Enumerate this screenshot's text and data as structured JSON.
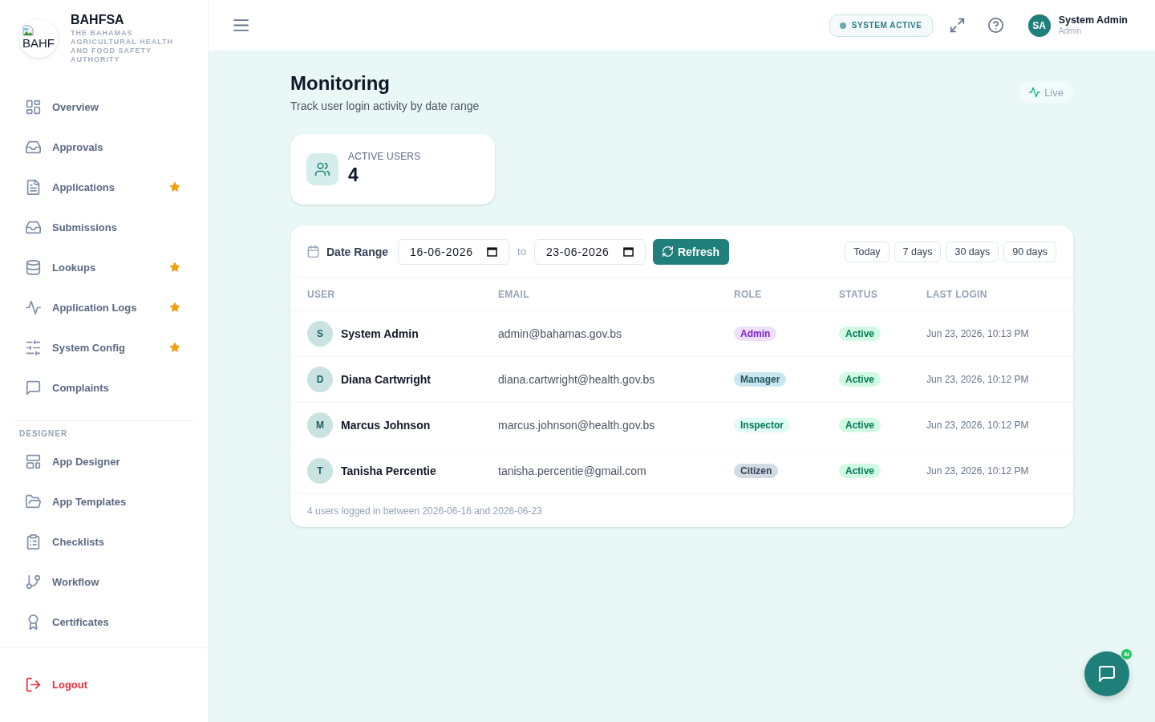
{
  "sidebar": {
    "brand": {
      "logo_text": "BAHF",
      "name": "BAHFSA",
      "subtitle": "THE BAHAMAS AGRICULTURAL HEALTH AND FOOD SAFETY AUTHORITY"
    },
    "items": [
      {
        "label": "Overview",
        "selected": false,
        "starred": false
      },
      {
        "label": "Approvals",
        "selected": false,
        "starred": false
      },
      {
        "label": "Applications",
        "selected": false,
        "starred": true
      },
      {
        "label": "Submissions",
        "selected": false,
        "starred": false
      },
      {
        "label": "Lookups",
        "selected": false,
        "starred": true
      },
      {
        "label": "Application Logs",
        "selected": false,
        "starred": true
      },
      {
        "label": "System Config",
        "selected": false,
        "starred": true
      },
      {
        "label": "Complaints",
        "selected": false,
        "starred": false
      }
    ],
    "sections": [
      {
        "title": "DESIGNER",
        "items": [
          {
            "label": "App Designer",
            "selected": false,
            "starred": false
          },
          {
            "label": "App Templates",
            "selected": false,
            "starred": false
          },
          {
            "label": "Checklists",
            "selected": false,
            "starred": false
          },
          {
            "label": "Workflow",
            "selected": false,
            "starred": false
          },
          {
            "label": "Certificates",
            "selected": false,
            "starred": false
          }
        ]
      }
    ],
    "logout": "Logout"
  },
  "header": {
    "system_status": "SYSTEM ACTIVE",
    "user": {
      "initials": "SA",
      "name": "System Admin",
      "role": "Admin"
    }
  },
  "page": {
    "title": "Monitoring",
    "subtitle": "Track user login activity by date range",
    "live": "Live"
  },
  "stats": [
    {
      "label": "ACTIVE USERS",
      "value": "4"
    }
  ],
  "activity_table": {
    "filter": {
      "label": "Date Range",
      "from": "16-06-2026",
      "separator": "to",
      "to": "23-06-2026",
      "refresh": "Refresh",
      "quick_ranges": [
        {
          "label": "Today",
          "selected": false
        },
        {
          "label": "7 days",
          "selected": false
        },
        {
          "label": "30 days",
          "selected": false
        },
        {
          "label": "90 days",
          "selected": false
        }
      ]
    },
    "columns": [
      "USER",
      "EMAIL",
      "ROLE",
      "STATUS",
      "LAST LOGIN"
    ],
    "rows": [
      {
        "initial": "S",
        "name": "System Admin",
        "email": "admin@bahamas.gov.bs",
        "role": {
          "label": "Admin",
          "color": "#7e22ce"
        },
        "status": "Active",
        "last_login": "Jun 23, 2026, 10:13 PM"
      },
      {
        "initial": "D",
        "name": "Diana Cartwright",
        "email": "diana.cartwright@health.gov.bs",
        "role": {
          "label": "Manager",
          "color": "#1f5560"
        },
        "status": "Active",
        "last_login": "Jun 23, 2026, 10:12 PM"
      },
      {
        "initial": "M",
        "name": "Marcus Johnson",
        "email": "marcus.johnson@health.gov.bs",
        "role": {
          "label": "Inspector",
          "color": "#047857"
        },
        "status": "Active",
        "last_login": "Jun 23, 2026, 10:12 PM"
      },
      {
        "initial": "T",
        "name": "Tanisha Percentie",
        "email": "tanisha.percentie@gmail.com",
        "role": {
          "label": "Citizen",
          "color": "#334155"
        },
        "status": "Active",
        "last_login": "Jun 23, 2026, 10:12 PM"
      }
    ],
    "footer": "4 users logged in between 2026-06-16 and 2026-06-23"
  },
  "chat_button": {
    "badge": "AI"
  }
}
